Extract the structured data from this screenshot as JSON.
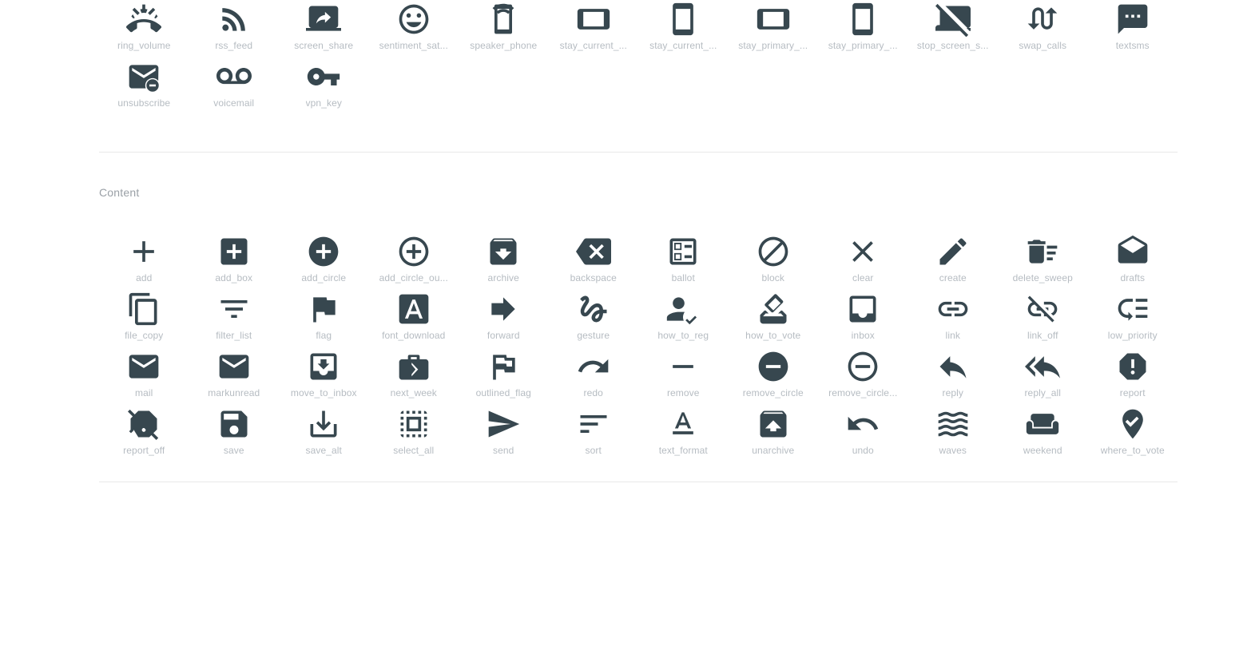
{
  "page": {
    "background": "#ffffff",
    "icon_color": "#37474f",
    "label_color": "#b6bcc2",
    "divider_color": "#e8e8e8",
    "section_title_color": "#9aa0a6"
  },
  "sections": [
    {
      "title": null,
      "icons": [
        {
          "label": "ring_volume",
          "icon": "ring-volume-icon"
        },
        {
          "label": "rss_feed",
          "icon": "rss-feed-icon"
        },
        {
          "label": "screen_share",
          "icon": "screen-share-icon"
        },
        {
          "label": "sentiment_sat...",
          "icon": "sentiment-satisfied-icon"
        },
        {
          "label": "speaker_phone",
          "icon": "speaker-phone-icon"
        },
        {
          "label": "stay_current_...",
          "icon": "stay-current-landscape-icon"
        },
        {
          "label": "stay_current_...",
          "icon": "stay-current-portrait-icon"
        },
        {
          "label": "stay_primary_...",
          "icon": "stay-primary-landscape-icon"
        },
        {
          "label": "stay_primary_...",
          "icon": "stay-primary-portrait-icon"
        },
        {
          "label": "stop_screen_s...",
          "icon": "stop-screen-share-icon"
        },
        {
          "label": "swap_calls",
          "icon": "swap-calls-icon"
        },
        {
          "label": "textsms",
          "icon": "textsms-icon"
        },
        {
          "label": "unsubscribe",
          "icon": "unsubscribe-icon"
        },
        {
          "label": "voicemail",
          "icon": "voicemail-icon"
        },
        {
          "label": "vpn_key",
          "icon": "vpn-key-icon"
        }
      ]
    },
    {
      "title": "Content",
      "icons": [
        {
          "label": "add",
          "icon": "add-icon"
        },
        {
          "label": "add_box",
          "icon": "add-box-icon"
        },
        {
          "label": "add_circle",
          "icon": "add-circle-icon"
        },
        {
          "label": "add_circle_ou...",
          "icon": "add-circle-outline-icon"
        },
        {
          "label": "archive",
          "icon": "archive-icon"
        },
        {
          "label": "backspace",
          "icon": "backspace-icon"
        },
        {
          "label": "ballot",
          "icon": "ballot-icon"
        },
        {
          "label": "block",
          "icon": "block-icon"
        },
        {
          "label": "clear",
          "icon": "clear-icon"
        },
        {
          "label": "create",
          "icon": "create-icon"
        },
        {
          "label": "delete_sweep",
          "icon": "delete-sweep-icon"
        },
        {
          "label": "drafts",
          "icon": "drafts-icon"
        },
        {
          "label": "file_copy",
          "icon": "file-copy-icon"
        },
        {
          "label": "filter_list",
          "icon": "filter-list-icon"
        },
        {
          "label": "flag",
          "icon": "flag-icon"
        },
        {
          "label": "font_download",
          "icon": "font-download-icon"
        },
        {
          "label": "forward",
          "icon": "forward-icon"
        },
        {
          "label": "gesture",
          "icon": "gesture-icon"
        },
        {
          "label": "how_to_reg",
          "icon": "how-to-reg-icon"
        },
        {
          "label": "how_to_vote",
          "icon": "how-to-vote-icon"
        },
        {
          "label": "inbox",
          "icon": "inbox-icon"
        },
        {
          "label": "link",
          "icon": "link-icon"
        },
        {
          "label": "link_off",
          "icon": "link-off-icon"
        },
        {
          "label": "low_priority",
          "icon": "low-priority-icon"
        },
        {
          "label": "mail",
          "icon": "mail-icon"
        },
        {
          "label": "markunread",
          "icon": "markunread-icon"
        },
        {
          "label": "move_to_inbox",
          "icon": "move-to-inbox-icon"
        },
        {
          "label": "next_week",
          "icon": "next-week-icon"
        },
        {
          "label": "outlined_flag",
          "icon": "outlined-flag-icon"
        },
        {
          "label": "redo",
          "icon": "redo-icon"
        },
        {
          "label": "remove",
          "icon": "remove-icon"
        },
        {
          "label": "remove_circle",
          "icon": "remove-circle-icon"
        },
        {
          "label": "remove_circle...",
          "icon": "remove-circle-outline-icon"
        },
        {
          "label": "reply",
          "icon": "reply-icon"
        },
        {
          "label": "reply_all",
          "icon": "reply-all-icon"
        },
        {
          "label": "report",
          "icon": "report-icon"
        },
        {
          "label": "report_off",
          "icon": "report-off-icon"
        },
        {
          "label": "save",
          "icon": "save-icon"
        },
        {
          "label": "save_alt",
          "icon": "save-alt-icon"
        },
        {
          "label": "select_all",
          "icon": "select-all-icon"
        },
        {
          "label": "send",
          "icon": "send-icon"
        },
        {
          "label": "sort",
          "icon": "sort-icon"
        },
        {
          "label": "text_format",
          "icon": "text-format-icon"
        },
        {
          "label": "unarchive",
          "icon": "unarchive-icon"
        },
        {
          "label": "undo",
          "icon": "undo-icon"
        },
        {
          "label": "waves",
          "icon": "waves-icon"
        },
        {
          "label": "weekend",
          "icon": "weekend-icon"
        },
        {
          "label": "where_to_vote",
          "icon": "where-to-vote-icon"
        }
      ]
    }
  ]
}
